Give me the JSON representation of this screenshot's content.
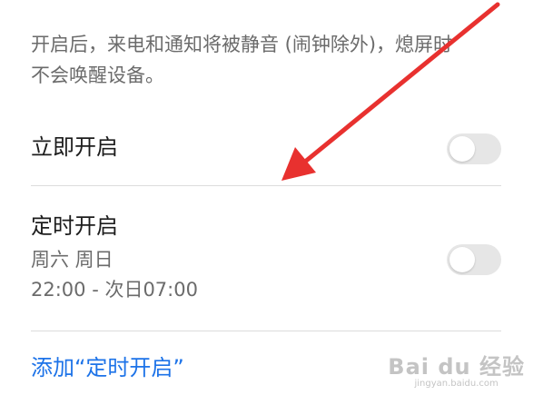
{
  "description": {
    "line1": "开启后，来电和通知将被静音 (闹钟除外)，熄屏时",
    "line2": "不会唤醒设备。"
  },
  "immediate": {
    "title": "立即开启",
    "toggle_on": false
  },
  "scheduled": {
    "title": "定时开启",
    "days": "周六 周日",
    "time_range": "22:00 - 次日07:00",
    "toggle_on": false
  },
  "add_schedule_label": "添加“定时开启”",
  "watermark": {
    "logo": "Bai du 经验",
    "url": "jingyan.baidu.com"
  },
  "colors": {
    "link": "#1d73e8",
    "arrow": "#e8312f",
    "toggle_off": "#e6e6e6"
  }
}
